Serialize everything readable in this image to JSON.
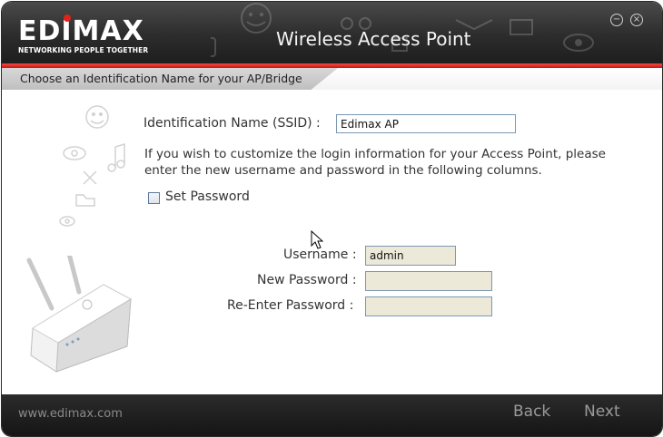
{
  "header": {
    "logo_text": "EDIMAX",
    "logo_tagline": "NETWORKING PEOPLE TOGETHER",
    "title": "Wireless Access Point",
    "minimize_glyph": "−",
    "close_glyph": "×"
  },
  "subheader": {
    "text": "Choose an Identification Name for your AP/Bridge"
  },
  "form": {
    "ssid_label": "Identification Name (SSID) :",
    "ssid_value": "Edimax AP",
    "info_text": "If you wish to customize the login information for your Access Point, please enter the new username and password in the following columns.",
    "set_password_label": "Set Password",
    "set_password_checked": false,
    "username_label": "Username :",
    "username_value": "admin",
    "new_password_label": "New Password :",
    "new_password_value": "",
    "reenter_password_label": "Re-Enter Password :",
    "reenter_password_value": ""
  },
  "footer": {
    "url": "www.edimax.com",
    "back_label": "Back",
    "next_label": "Next"
  },
  "colors": {
    "accent_red": "#e2231a",
    "header_dark": "#2c2c2c",
    "input_disabled_bg": "#ece9d8"
  }
}
